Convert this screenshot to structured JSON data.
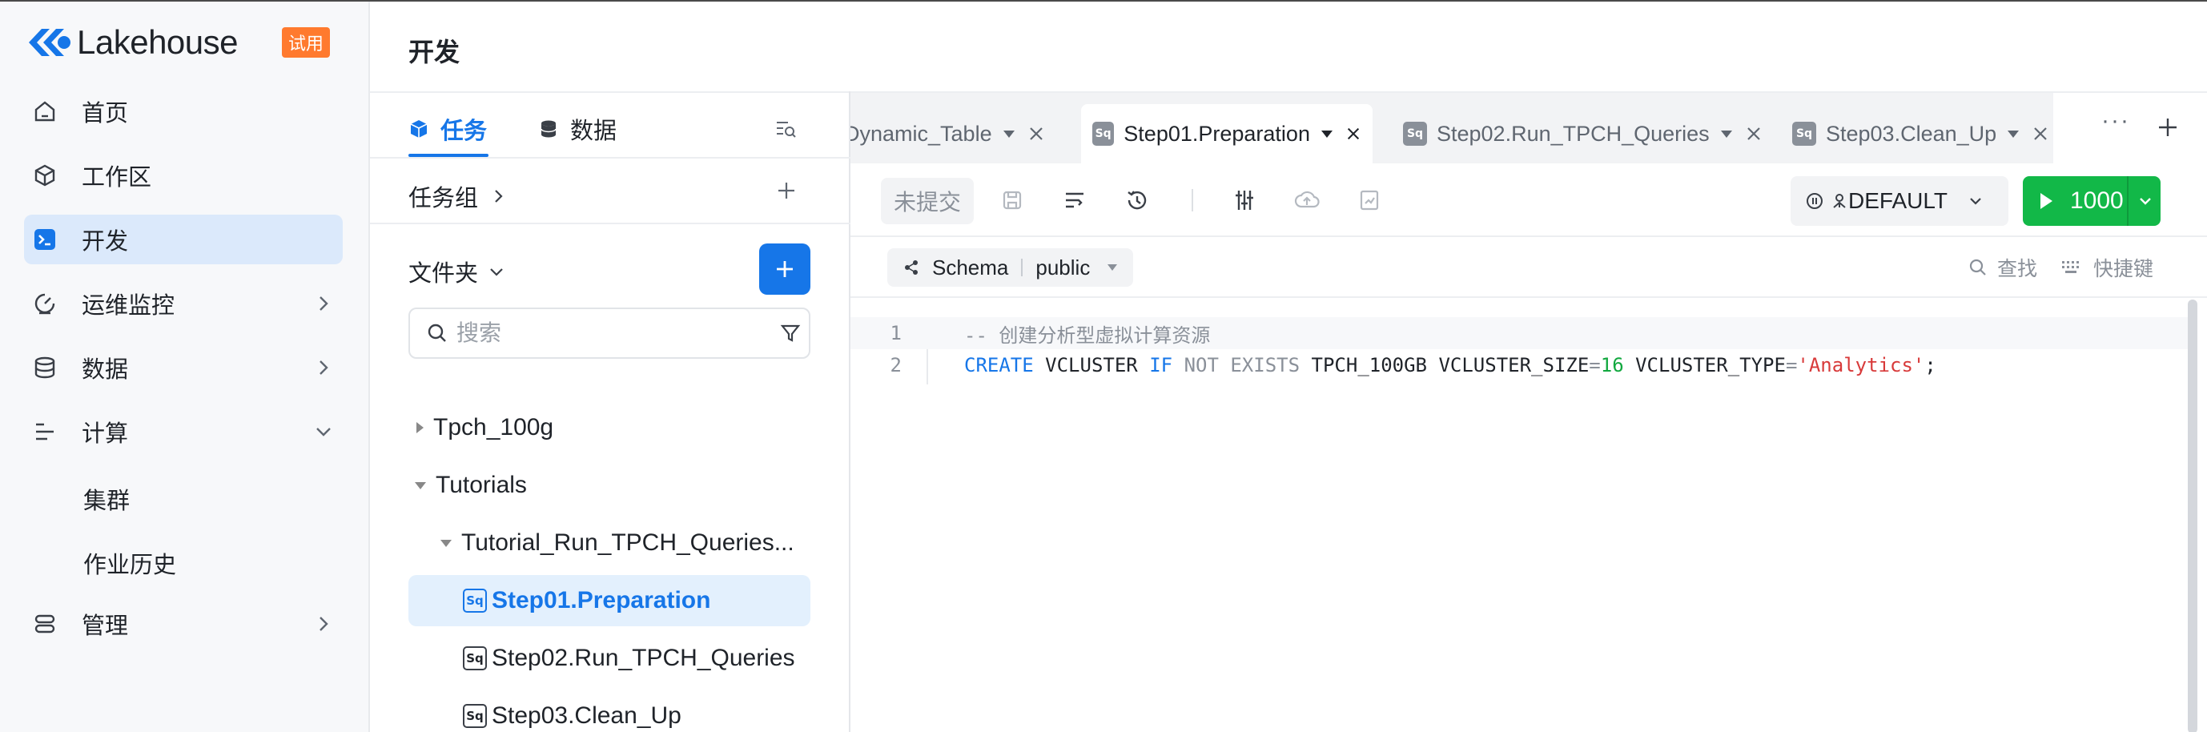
{
  "app": {
    "name": "Lakehouse",
    "trial_badge": "试用",
    "brand_color": "#1676e8"
  },
  "nav": {
    "items": [
      {
        "label": "首页",
        "icon": "home-icon"
      },
      {
        "label": "工作区",
        "icon": "cube-icon"
      },
      {
        "label": "开发",
        "icon": "terminal-icon",
        "active": true
      },
      {
        "label": "运维监控",
        "icon": "monitor-icon"
      },
      {
        "label": "数据",
        "icon": "database-icon"
      },
      {
        "label": "计算",
        "icon": "compute-icon",
        "expanded": true
      },
      {
        "label": "管理",
        "icon": "manage-icon"
      }
    ],
    "sub_items": [
      "集群",
      "作业历史"
    ]
  },
  "header": {
    "title": "开发"
  },
  "panel": {
    "tabs": [
      "任务",
      "数据"
    ],
    "active_tab": "任务",
    "task_group_label": "任务组",
    "folder_label": "文件夹",
    "search_placeholder": "搜索",
    "tree": [
      {
        "label": "Tpch_100g",
        "expanded": false
      },
      {
        "label": "Tutorials",
        "expanded": true
      },
      {
        "label": "Tutorial_Run_TPCH_Queries...",
        "expanded": true
      },
      {
        "label": "Step01.Preparation",
        "type": "sql",
        "selected": true
      },
      {
        "label": "Step02.Run_TPCH_Queries",
        "type": "sql"
      },
      {
        "label": "Step03.Clean_Up",
        "type": "sql"
      }
    ],
    "sql_badge": "Sq"
  },
  "editor": {
    "tabs": [
      {
        "label": "Dynamic_Table"
      },
      {
        "label": "Step01.Preparation",
        "active": true
      },
      {
        "label": "Step02.Run_TPCH_Queries"
      },
      {
        "label": "Step03.Clean_Up"
      }
    ],
    "more": "···",
    "toolbar": {
      "status": "未提交",
      "cluster": "DEFAULT",
      "run_limit": "1000",
      "run_color": "#12b848"
    },
    "schema": {
      "label": "Schema",
      "value": "public"
    },
    "find_label": "查找",
    "shortcuts_label": "快捷键",
    "lines": [
      {
        "no": "1",
        "comment": "-- 创建分析型虚拟计算资源"
      },
      {
        "no": "2",
        "kw1": "CREATE",
        "id1": "VCLUSTER",
        "kw2": "IF",
        "gr1": "NOT EXISTS",
        "id2": "TPCH_100GB VCLUSTER_SIZE",
        "eq1": "=",
        "num": "16",
        "id3": "VCLUSTER_TYPE",
        "eq2": "=",
        "str": "'Analytics'",
        "end": ";"
      }
    ]
  }
}
